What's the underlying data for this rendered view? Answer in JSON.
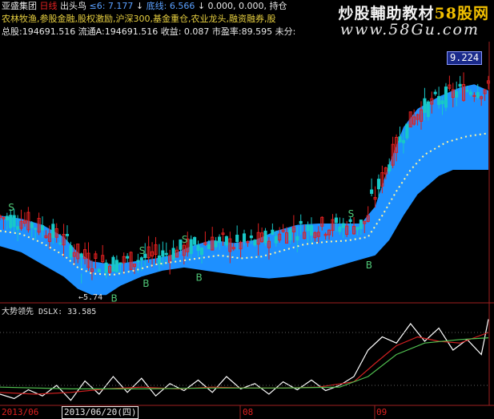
{
  "header": {
    "line1": [
      {
        "text": "亚盛集团",
        "color": "#e8e8e8"
      },
      {
        "text": "日线",
        "color": "#e02020"
      },
      {
        "text": "出头鸟",
        "color": "#e8e8e8"
      },
      {
        "text": "≤6: 7.177",
        "color": "#5aa0ff"
      },
      {
        "text": "↓",
        "color": "#e8e8e8"
      },
      {
        "text": "底线: 6.566",
        "color": "#5aa0ff"
      },
      {
        "text": "↓ 0.000, 0.000, 持仓",
        "color": "#e8e8e8"
      }
    ],
    "line2": "农林牧渔,参股金融,股权激励,沪深300,基金重仓,农业龙头,融资融券,股",
    "line3": "总股:194691.516 流通A:194691.516 收益: 0.087 市盈率:89.595 未分:"
  },
  "watermark": {
    "part1": "炒股輔助教材",
    "part2": "58股网",
    "url": "www.58Gu.com"
  },
  "price_box": "9.224",
  "low_label": "←5.74",
  "sub_indicator": {
    "name": "大势领先",
    "value_label": "DSLX: 33.585"
  },
  "x_axis": {
    "labels": [
      "2013/06",
      "08",
      "09"
    ],
    "selected_date": "2013/06/20(四)"
  },
  "colors": {
    "band": "#1e90ff",
    "up": "#e02020",
    "down": "#18c8c8",
    "mid": "#fff6a0",
    "osc_white": "#ffffff",
    "osc_red": "#d02020",
    "osc_green": "#50c050",
    "osc_yellow": "#e0c030"
  },
  "chart_data": {
    "type": "candlestick",
    "n": 115,
    "price_range": [
      5.5,
      9.7
    ],
    "signals": [
      {
        "label": "S",
        "i": 3,
        "color": "#50c878"
      },
      {
        "label": "B",
        "i": 32,
        "color": "#50c878"
      },
      {
        "label": "S",
        "i": 40,
        "color": "#50c878"
      },
      {
        "label": "B",
        "i": 41,
        "color": "#50c878"
      },
      {
        "label": "S",
        "i": 52,
        "color": "#50c878"
      },
      {
        "label": "B",
        "i": 56,
        "color": "#50c878"
      },
      {
        "label": "S",
        "i": 99,
        "color": "#50c878"
      },
      {
        "label": "B",
        "i": 104,
        "color": "#50c878"
      }
    ],
    "band_upper": [
      [
        0,
        6.85
      ],
      [
        6,
        6.8
      ],
      [
        12,
        6.7
      ],
      [
        18,
        6.5
      ],
      [
        22,
        6.25
      ],
      [
        26,
        6.1
      ],
      [
        32,
        6.05
      ],
      [
        38,
        6.1
      ],
      [
        44,
        6.15
      ],
      [
        48,
        6.2
      ],
      [
        54,
        6.35
      ],
      [
        60,
        6.45
      ],
      [
        66,
        6.4
      ],
      [
        72,
        6.45
      ],
      [
        78,
        6.6
      ],
      [
        84,
        6.7
      ],
      [
        90,
        6.72
      ],
      [
        96,
        6.72
      ],
      [
        102,
        6.72
      ],
      [
        106,
        7.0
      ],
      [
        110,
        7.7
      ],
      [
        114,
        8.3
      ],
      [
        118,
        8.6
      ],
      [
        124,
        8.8
      ],
      [
        130,
        8.95
      ],
      [
        134,
        9.0
      ],
      [
        138,
        8.9
      ]
    ],
    "band_lower": [
      [
        0,
        6.35
      ],
      [
        6,
        6.25
      ],
      [
        12,
        6.05
      ],
      [
        18,
        5.85
      ],
      [
        22,
        5.65
      ],
      [
        26,
        5.55
      ],
      [
        30,
        5.55
      ],
      [
        34,
        5.7
      ],
      [
        40,
        5.85
      ],
      [
        46,
        5.95
      ],
      [
        52,
        6.0
      ],
      [
        58,
        5.95
      ],
      [
        64,
        5.9
      ],
      [
        70,
        5.85
      ],
      [
        76,
        5.82
      ],
      [
        82,
        5.85
      ],
      [
        88,
        5.9
      ],
      [
        94,
        6.0
      ],
      [
        100,
        6.1
      ],
      [
        106,
        6.2
      ],
      [
        110,
        6.45
      ],
      [
        114,
        6.85
      ],
      [
        118,
        7.2
      ],
      [
        124,
        7.5
      ],
      [
        128,
        7.6
      ],
      [
        132,
        7.6
      ],
      [
        138,
        7.6
      ]
    ],
    "mid_line": [
      [
        0,
        6.6
      ],
      [
        6,
        6.55
      ],
      [
        12,
        6.4
      ],
      [
        18,
        6.2
      ],
      [
        22,
        6.0
      ],
      [
        26,
        5.9
      ],
      [
        32,
        5.88
      ],
      [
        38,
        5.95
      ],
      [
        44,
        6.05
      ],
      [
        50,
        6.1
      ],
      [
        56,
        6.15
      ],
      [
        62,
        6.2
      ],
      [
        68,
        6.15
      ],
      [
        74,
        6.18
      ],
      [
        80,
        6.28
      ],
      [
        86,
        6.38
      ],
      [
        92,
        6.42
      ],
      [
        98,
        6.44
      ],
      [
        104,
        6.5
      ],
      [
        108,
        6.85
      ],
      [
        112,
        7.25
      ],
      [
        116,
        7.6
      ],
      [
        120,
        7.85
      ],
      [
        126,
        8.05
      ],
      [
        132,
        8.15
      ],
      [
        138,
        8.2
      ]
    ],
    "oscillator": {
      "range": [
        0,
        100
      ],
      "white": [
        [
          0,
          10
        ],
        [
          4,
          5
        ],
        [
          8,
          15
        ],
        [
          12,
          8
        ],
        [
          16,
          20
        ],
        [
          20,
          3
        ],
        [
          24,
          25
        ],
        [
          28,
          10
        ],
        [
          32,
          30
        ],
        [
          36,
          12
        ],
        [
          40,
          28
        ],
        [
          44,
          8
        ],
        [
          48,
          22
        ],
        [
          52,
          14
        ],
        [
          56,
          26
        ],
        [
          60,
          12
        ],
        [
          64,
          30
        ],
        [
          68,
          16
        ],
        [
          72,
          22
        ],
        [
          76,
          10
        ],
        [
          80,
          24
        ],
        [
          84,
          15
        ],
        [
          88,
          26
        ],
        [
          92,
          14
        ],
        [
          96,
          20
        ],
        [
          100,
          30
        ],
        [
          104,
          60
        ],
        [
          108,
          75
        ],
        [
          112,
          68
        ],
        [
          116,
          90
        ],
        [
          120,
          70
        ],
        [
          124,
          85
        ],
        [
          128,
          60
        ],
        [
          132,
          72
        ],
        [
          136,
          55
        ],
        [
          138,
          95
        ]
      ],
      "red": [
        [
          0,
          12
        ],
        [
          10,
          10
        ],
        [
          20,
          12
        ],
        [
          30,
          16
        ],
        [
          40,
          18
        ],
        [
          50,
          16
        ],
        [
          60,
          18
        ],
        [
          70,
          17
        ],
        [
          80,
          17
        ],
        [
          90,
          18
        ],
        [
          100,
          24
        ],
        [
          106,
          45
        ],
        [
          112,
          65
        ],
        [
          118,
          75
        ],
        [
          124,
          70
        ],
        [
          130,
          68
        ],
        [
          138,
          80
        ]
      ],
      "green": [
        [
          0,
          18
        ],
        [
          20,
          16
        ],
        [
          40,
          16
        ],
        [
          60,
          17
        ],
        [
          80,
          17
        ],
        [
          96,
          18
        ],
        [
          104,
          30
        ],
        [
          112,
          55
        ],
        [
          120,
          68
        ],
        [
          130,
          72
        ],
        [
          138,
          74
        ]
      ]
    }
  }
}
